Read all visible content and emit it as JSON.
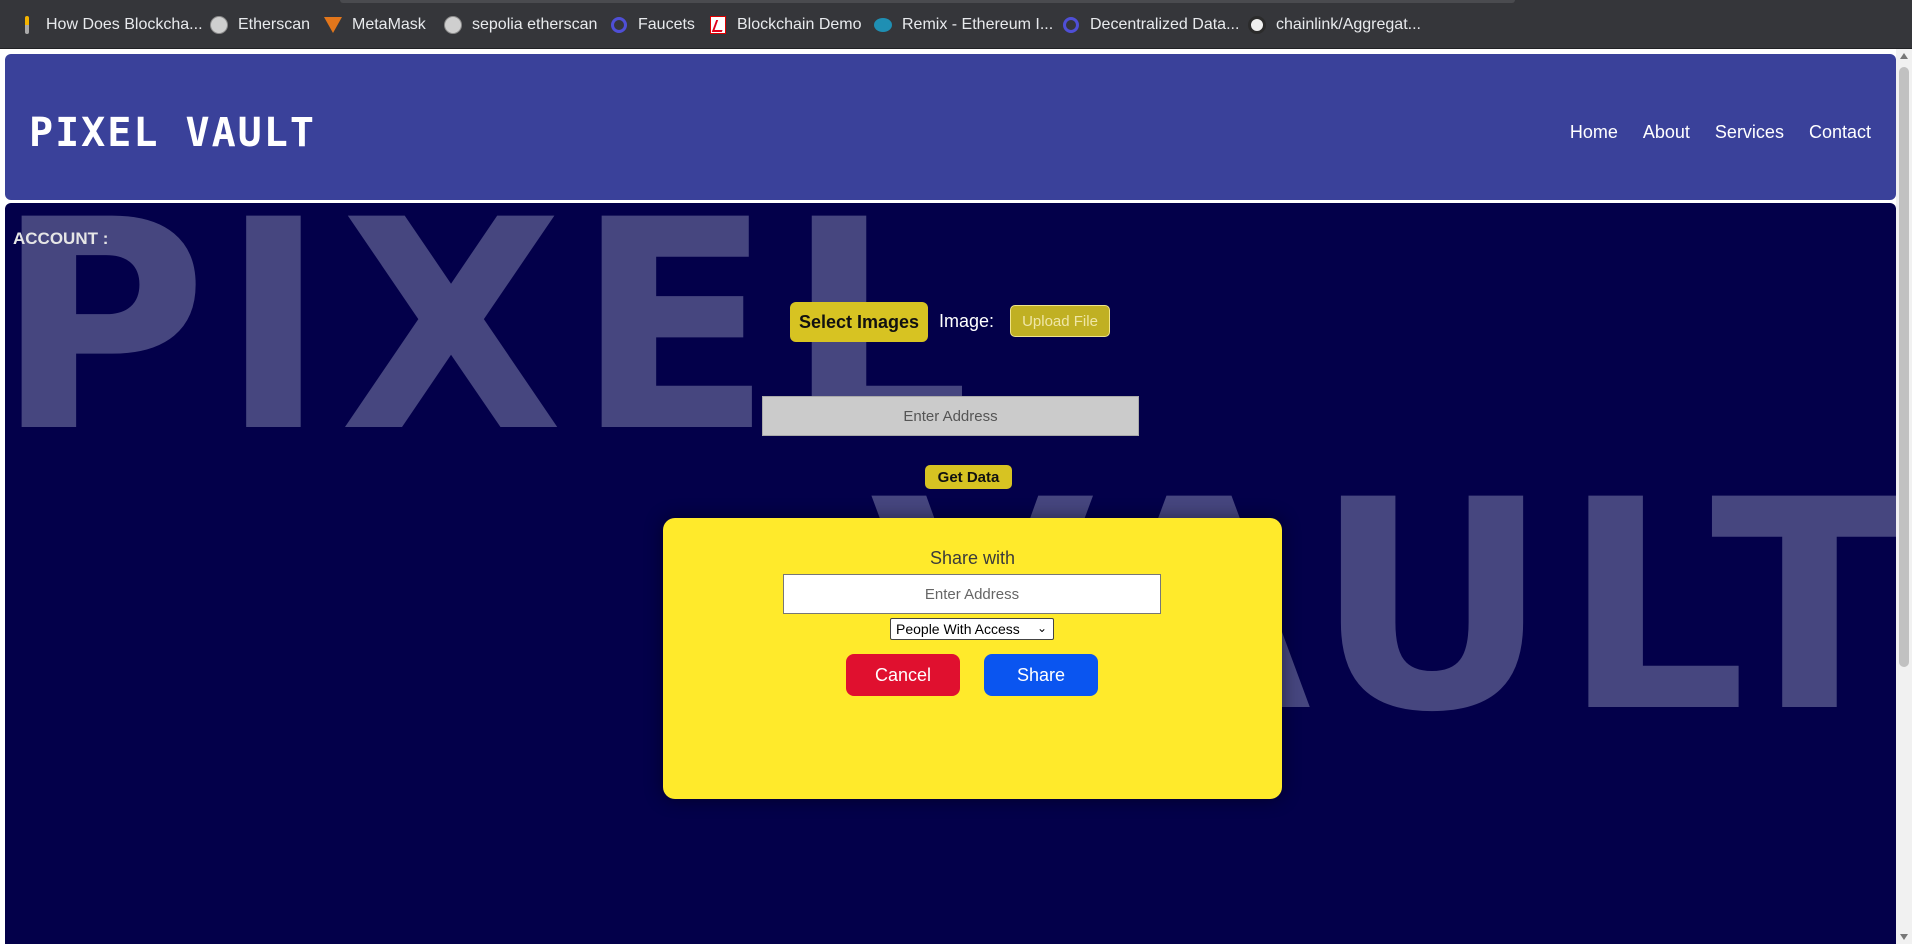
{
  "bookmarks": [
    {
      "label": "How Does Blockcha...",
      "icon": "bar-icon"
    },
    {
      "label": "Etherscan",
      "icon": "etherscan-icon"
    },
    {
      "label": "MetaMask",
      "icon": "metamask-fox-icon"
    },
    {
      "label": "sepolia etherscan",
      "icon": "etherscan-icon"
    },
    {
      "label": "Faucets",
      "icon": "hexagon-icon"
    },
    {
      "label": "Blockchain Demo",
      "icon": "pdf-icon"
    },
    {
      "label": "Remix - Ethereum I...",
      "icon": "remix-icon"
    },
    {
      "label": "Decentralized Data...",
      "icon": "hexagon-icon"
    },
    {
      "label": "chainlink/Aggregat...",
      "icon": "github-icon"
    }
  ],
  "header": {
    "brand": "PIXEL VAULT",
    "nav": [
      "Home",
      "About",
      "Services",
      "Contact"
    ]
  },
  "main": {
    "background_words": [
      "PIXEL",
      "VAULT"
    ],
    "account_label": "ACCOUNT :",
    "select_images_label": "Select Images",
    "image_label": "Image:",
    "upload_file_label": "Upload File",
    "address_placeholder": "Enter Address",
    "get_data_label": "Get Data"
  },
  "modal": {
    "title": "Share with",
    "address_placeholder": "Enter Address",
    "access_select_value": "People With Access",
    "cancel_label": "Cancel",
    "share_label": "Share"
  },
  "colors": {
    "header_bg": "#3a419a",
    "main_bg": "#03004a",
    "modal_bg": "#ffea2b",
    "accent_gold": "#d7c322",
    "cancel": "#e0102f",
    "share": "#0a55f0"
  }
}
